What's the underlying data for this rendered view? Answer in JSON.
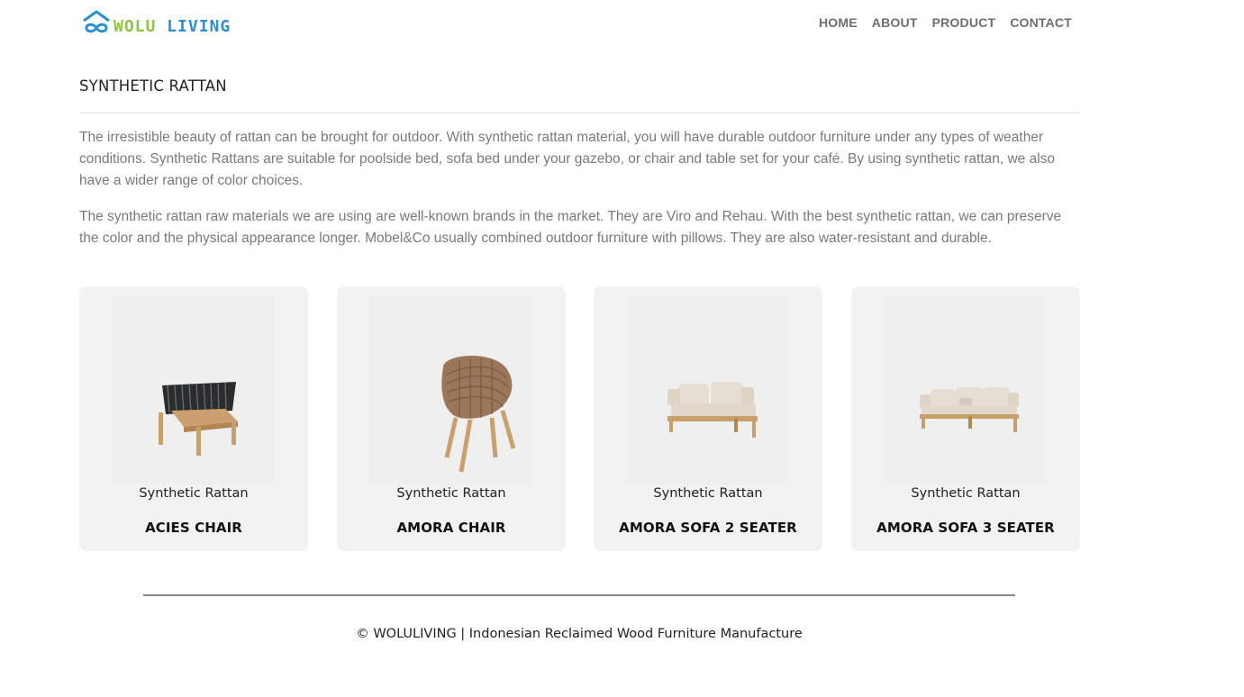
{
  "brand": {
    "word1": "WOLU",
    "word2": "LIVING",
    "icon": "house-infinity-logo-icon",
    "colors": {
      "green": "#8dc63f",
      "blue": "#2b8fd6"
    }
  },
  "nav": {
    "items": [
      "HOME",
      "ABOUT",
      "PRODUCT",
      "CONTACT"
    ]
  },
  "page": {
    "title": "SYNTHETIC RATTAN",
    "paragraphs": [
      "The irresistible beauty of rattan can be brought for outdoor. With synthetic rattan material, you will have durable outdoor furniture under any types of weather conditions. Synthetic Rattans are suitable for poolside bed, sofa bed under your gazebo, or chair and table set for your café. By using synthetic rattan, we also have a wider range of color choices.",
      "The synthetic rattan raw materials we are using are well-known brands in the market. They are Viro and Rehau. With the best synthetic rattan, we can preserve the color and the physical appearance longer. Mobel&Co usually combined outdoor furniture with pillows. They are also water-resistant and durable."
    ]
  },
  "products": [
    {
      "category": "Synthetic Rattan",
      "name": "ACIES CHAIR",
      "image": "acies-chair-image"
    },
    {
      "category": "Synthetic Rattan",
      "name": "AMORA CHAIR",
      "image": "amora-chair-image"
    },
    {
      "category": "Synthetic Rattan",
      "name": "AMORA SOFA 2 SEATER",
      "image": "amora-sofa-2-seater-image"
    },
    {
      "category": "Synthetic Rattan",
      "name": "AMORA SOFA 3 SEATER",
      "image": "amora-sofa-3-seater-image"
    }
  ],
  "footer": {
    "text": "© WOLULIVING | Indonesian Reclaimed Wood Furniture Manufacture"
  }
}
